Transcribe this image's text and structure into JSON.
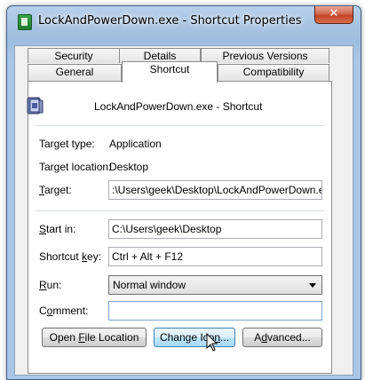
{
  "window": {
    "title": "LockAndPowerDown.exe - Shortcut Properties",
    "close_label": "✕"
  },
  "tabs": {
    "row1": [
      "Security",
      "Details",
      "Previous Versions"
    ],
    "row2": [
      "General",
      "Shortcut",
      "Compatibility"
    ],
    "active": "Shortcut"
  },
  "shortcut": {
    "name": "LockAndPowerDown.exe - Shortcut",
    "target_type_label": "Target type:",
    "target_type": "Application",
    "target_location_label": "Target location:",
    "target_location": "Desktop",
    "target_label_pre": "",
    "target_label_u": "T",
    "target_label_post": "arget:",
    "target": ":\\Users\\geek\\Desktop\\LockAndPowerDown.exe",
    "start_in_label_pre": "",
    "start_in_label_u": "S",
    "start_in_label_post": "tart in:",
    "start_in": "C:\\Users\\geek\\Desktop",
    "shortcut_key_label_pre": "Shortcut ",
    "shortcut_key_label_u": "k",
    "shortcut_key_label_post": "ey:",
    "shortcut_key": "Ctrl + Alt + F12",
    "run_label_pre": "",
    "run_label_u": "R",
    "run_label_post": "un:",
    "run": "Normal window",
    "comment_label_pre": "C",
    "comment_label_u": "o",
    "comment_label_post": "mment:",
    "comment": ""
  },
  "buttons": {
    "open_pre": "Open ",
    "open_u": "F",
    "open_post": "ile Location",
    "change_pre": "Change Ico",
    "change_u": "n",
    "change_post": "...",
    "advanced_pre": "A",
    "advanced_u": "d",
    "advanced_post": "vanced..."
  },
  "icons": {
    "title_icon": "shortcut-app-icon",
    "app_icon": "lock-app-icon",
    "cursor": "mouse-pointer-icon"
  }
}
